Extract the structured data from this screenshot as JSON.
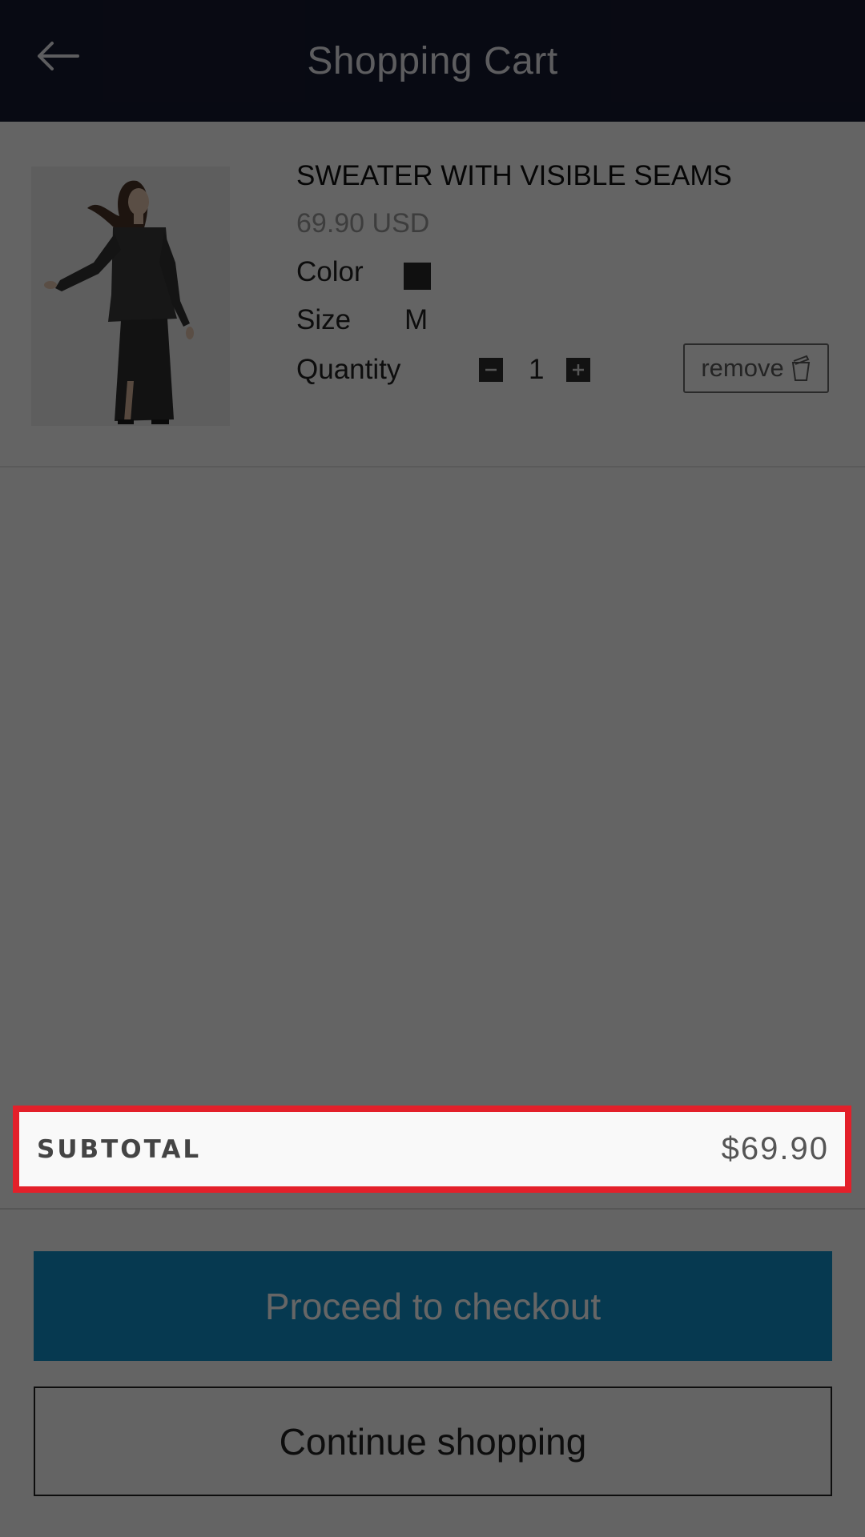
{
  "header": {
    "title": "Shopping Cart",
    "back_icon": "arrow-left-icon"
  },
  "cart": {
    "item": {
      "name": "SWEATER WITH VISIBLE SEAMS",
      "price": "69.90 USD",
      "color_label": "Color",
      "color_value": "#2a2a2a",
      "size_label": "Size",
      "size_value": "M",
      "quantity_label": "Quantity",
      "quantity_value": "1",
      "remove_label": "remove",
      "remove_icon": "trash-icon"
    }
  },
  "subtotal": {
    "label": "SUBTOTAL",
    "value": "$69.90"
  },
  "actions": {
    "checkout_label": "Proceed to checkout",
    "continue_label": "Continue shopping"
  },
  "colors": {
    "header_bg": "#161a30",
    "checkout_bg": "#0f8ec8",
    "highlight": "#e3202a"
  }
}
